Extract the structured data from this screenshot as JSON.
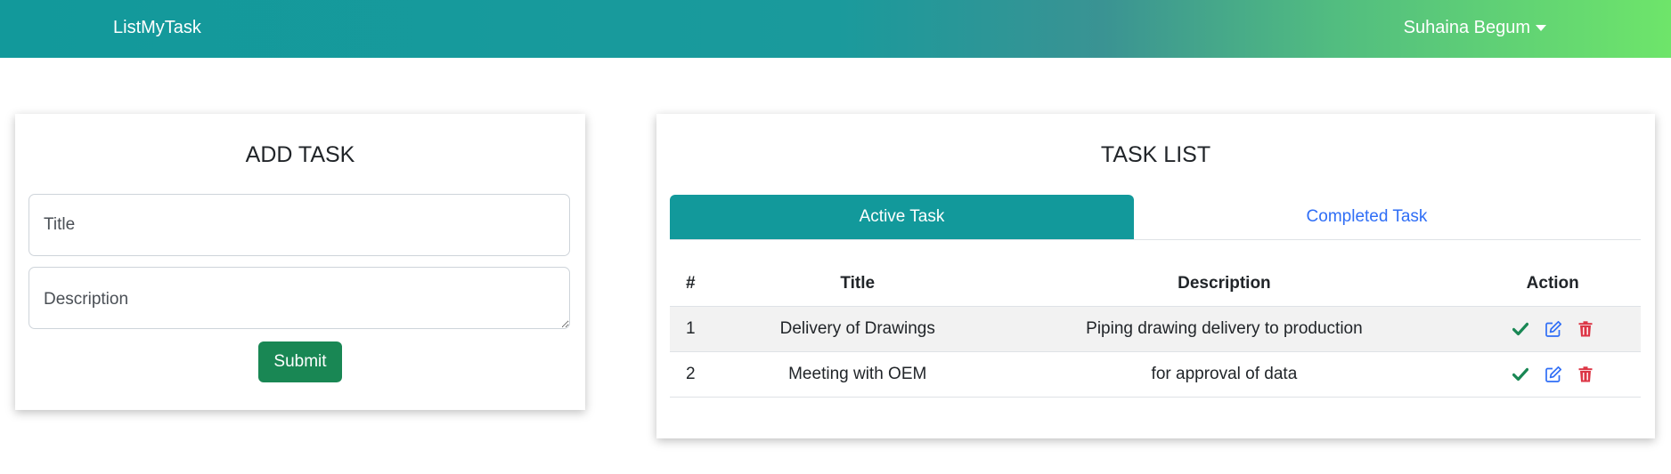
{
  "navbar": {
    "brand": "ListMyTask",
    "user_name": "Suhaina Begum"
  },
  "add_task": {
    "heading": "ADD TASK",
    "title_placeholder": "Title",
    "description_placeholder": "Description",
    "submit_label": "Submit"
  },
  "task_list": {
    "heading": "TASK LIST",
    "tabs": [
      {
        "label": "Active Task",
        "active": true
      },
      {
        "label": "Completed Task",
        "active": false
      }
    ],
    "columns": [
      "#",
      "Title",
      "Description",
      "Action"
    ],
    "rows": [
      {
        "num": "1",
        "title": "Delivery of Drawings",
        "description": "Piping drawing delivery to production"
      },
      {
        "num": "2",
        "title": "Meeting with OEM",
        "description": "for approval of data"
      }
    ]
  },
  "icons": {
    "complete": "check-icon",
    "edit": "edit-icon",
    "delete": "trash-icon"
  },
  "colors": {
    "primary_teal": "#12999b",
    "nav_gradient_end": "#6ee56a",
    "submit_green": "#198754",
    "link_blue": "#2f6ef6",
    "check_green": "#198754",
    "delete_red": "#dc3545"
  }
}
